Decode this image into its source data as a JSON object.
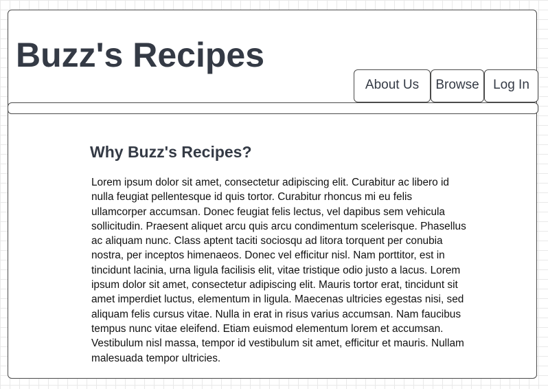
{
  "header": {
    "site_title": "Buzz's Recipes",
    "nav": {
      "about": "About Us",
      "browse": "Browse",
      "login": "Log In"
    }
  },
  "main": {
    "heading": "Why Buzz's Recipes?",
    "body": "Lorem ipsum dolor sit amet, consectetur adipiscing elit. Curabitur ac libero id nulla feugiat pellentesque id quis tortor. Curabitur rhoncus mi eu felis ullamcorper accumsan. Donec feugiat felis lectus, vel dapibus sem vehicula sollicitudin. Praesent aliquet arcu quis arcu condimentum scelerisque. Phasellus ac aliquam nunc. Class aptent taciti sociosqu ad litora torquent per conubia nostra, per inceptos himenaeos. Donec vel efficitur nisl. Nam porttitor, est in tincidunt lacinia, urna ligula facilisis elit, vitae tristique odio justo a lacus. Lorem ipsum dolor sit amet, consectetur adipiscing elit. Mauris tortor erat, tincidunt sit amet imperdiet luctus, elementum in ligula. Maecenas ultricies egestas nisi, sed aliquam felis cursus vitae. Nulla in erat in risus varius accumsan. Nam faucibus tempus nunc vitae eleifend. Etiam euismod elementum lorem et accumsan. Vestibulum nisl massa, tempor id vestibulum sit amet, efficitur et mauris. Nullam malesuada tempor ultricies."
  }
}
